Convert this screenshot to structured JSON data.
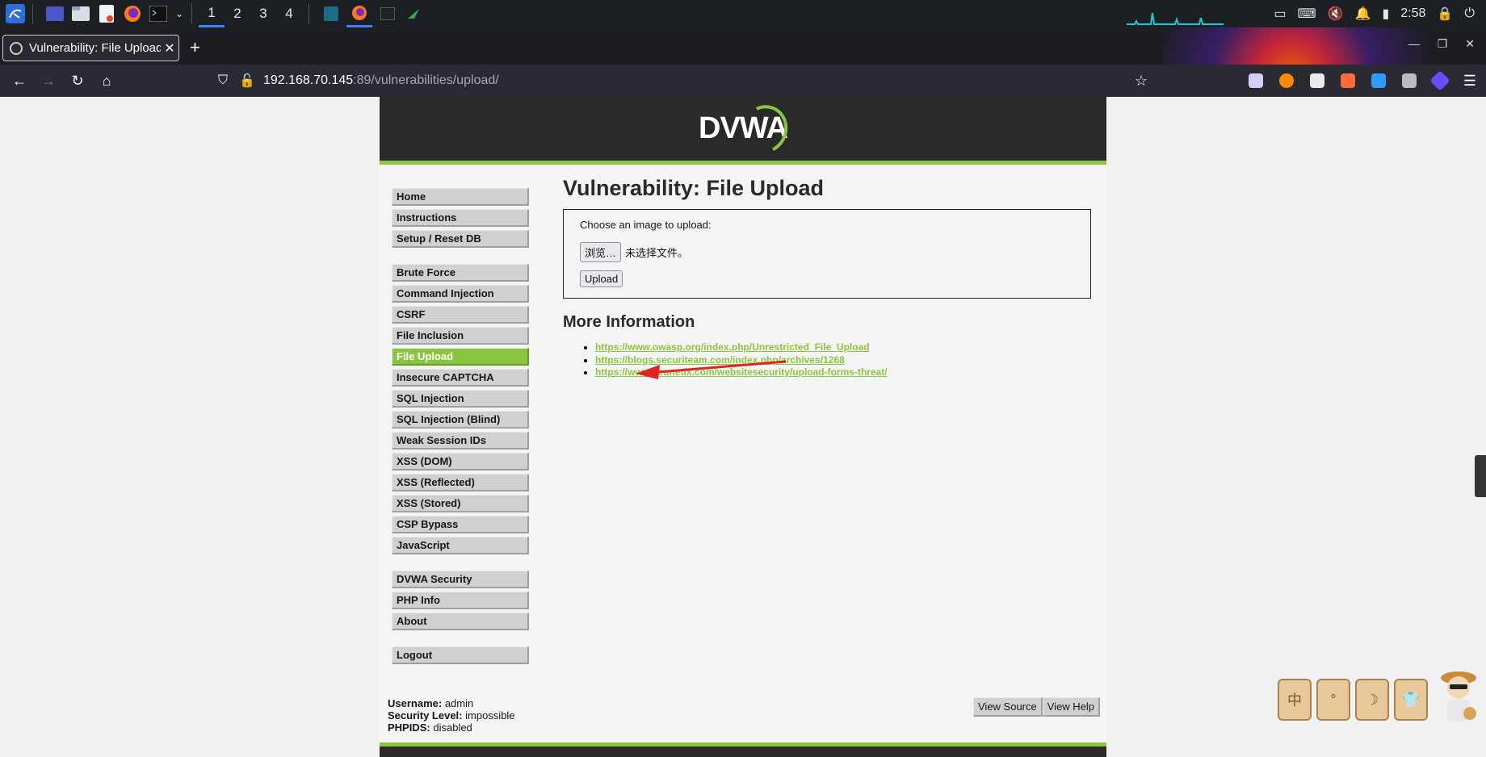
{
  "taskbar": {
    "workspaces": [
      "1",
      "2",
      "3",
      "4"
    ],
    "active_workspace": "1",
    "clock": "2:58"
  },
  "browser": {
    "tab_title": "Vulnerability: File Upload",
    "tab_close": "✕",
    "new_tab": "+",
    "url_host": "192.168.70.145",
    "url_rest": ":89/vulnerabilities/upload/",
    "window_controls": [
      "—",
      "❐",
      "✕"
    ]
  },
  "dvwa": {
    "logo": "DVWA",
    "menu": {
      "group1": [
        "Home",
        "Instructions",
        "Setup / Reset DB"
      ],
      "group2": [
        "Brute Force",
        "Command Injection",
        "CSRF",
        "File Inclusion",
        "File Upload",
        "Insecure CAPTCHA",
        "SQL Injection",
        "SQL Injection (Blind)",
        "Weak Session IDs",
        "XSS (DOM)",
        "XSS (Reflected)",
        "XSS (Stored)",
        "CSP Bypass",
        "JavaScript"
      ],
      "group3": [
        "DVWA Security",
        "PHP Info",
        "About"
      ],
      "group4": [
        "Logout"
      ],
      "selected": "File Upload"
    },
    "main": {
      "title": "Vulnerability: File Upload",
      "prompt": "Choose an image to upload:",
      "browse_button": "浏览…",
      "no_file": "未选择文件。",
      "upload_button": "Upload",
      "more_info_title": "More Information",
      "links": [
        "https://www.owasp.org/index.php/Unrestricted_File_Upload",
        "https://blogs.securiteam.com/index.php/archives/1268",
        "https://www.acunetix.com/websitesecurity/upload-forms-threat/"
      ]
    },
    "footer": {
      "username_label": "Username:",
      "username": "admin",
      "security_label": "Security Level:",
      "security": "impossible",
      "phpids_label": "PHPIDS:",
      "phpids": "disabled",
      "view_source": "View Source",
      "view_help": "View Help"
    }
  },
  "widgets": [
    "中",
    "°",
    "☽",
    "👕"
  ],
  "colors": {
    "accent": "#8bc53f",
    "header": "#2a2a2a",
    "arrow": "#e02424"
  }
}
